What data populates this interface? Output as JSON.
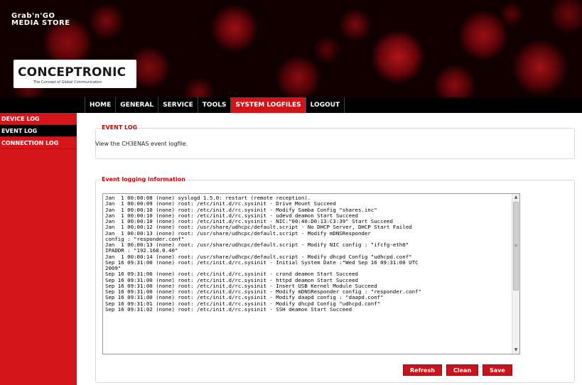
{
  "banner": {
    "store_line1": "Grab'n'GO",
    "store_line2": "MEDIA STORE",
    "brand_name": "CONCEPTRONIC",
    "brand_tagline": "The Concept of Global Communication"
  },
  "nav": {
    "items": [
      {
        "label": "HOME"
      },
      {
        "label": "GENERAL"
      },
      {
        "label": "SERVICE"
      },
      {
        "label": "TOOLS"
      },
      {
        "label": "SYSTEM LOGFILES",
        "active": true
      },
      {
        "label": "LOGOUT"
      }
    ],
    "active_color": "#d01418"
  },
  "sidebar": {
    "items": [
      {
        "label": "DEVICE LOG"
      },
      {
        "label": "EVENT LOG",
        "active": true
      },
      {
        "label": "CONNECTION LOG"
      }
    ],
    "color": "#d4161b"
  },
  "event_log": {
    "title": "EVENT LOG",
    "description": "View the CH3ENAS event logfile."
  },
  "info": {
    "title": "Event logging information",
    "log": "Jan  1 00:00:08 (none) syslogd 1.5.0: restart (remote reception).\nJan  1 00:00:09 (none) root: /etc/init.d/rc.sysinit - Drive Mount Succeed\nJan  1 00:00:10 (none) root: /etc/init.d/rc.sysinit - Modify Samba Config \"shares.inc\"\nJan  1 00:00:10 (none) root: /etc/init.d/rc.sysinit - udevd deamon Start Succeed\nJan  1 00:00:10 (none) root: /etc/init.d/rc.sysinit - NIC:\"00:40:D0:13:C3:39\" Start Succeed\nJan  1 00:00:12 (none) root: /usr/share/udhcpc/default.script - No DHCP Server, DHCP Start Failed\nJan  1 00:00:13 (none) root: /usr/share/udhcpc/default.script - Modify mDNSResponder\nconfig : \"responder.conf\"\nJan  1 00:00:13 (none) root: /usr/share/udhcpc/default.script - Modify NIC config : \"ifcfg-eth0\"\nIPADDR : \"192.168.0.40\"\nJan  1 00:00:14 (none) root: /usr/share/udhcpc/default.script - Modify dhcpd Config \"udhcpd.conf\"\nSep 16 09:31:00 (none) root: /etc/init.d/rc.sysinit - Initial System Date :\"Wed Sep 16 09:31:00 UTC\n2009\"\nSep 16 09:31:00 (none) root: /etc/init.d/rc.sysinit - crond deamon Start Succeed\nSep 16 09:31:00 (none) root: /etc/init.d/rc.sysinit - httpd deamon Start Succeed\nSep 16 09:31:00 (none) root: /etc/init.d/rc.sysinit - Insert USB Kernel Module Succeed\nSep 16 09:31:00 (none) root: /etc/init.d/rc.sysinit - Modify mDNSResponder config : \"responder.conf\"\nSep 16 09:31:00 (none) root: /etc/init.d/rc.sysinit - Modify daapd config : \"daapd.conf\"\nSep 16 09:31:01 (none) root: /etc/init.d/rc.sysinit - Modify dhcpd Config \"udhcpd.conf\"\nSep 16 09:31:02 (none) root: /etc/init.d/rc.sysinit - SSH deamon Start Succeed"
  },
  "buttons": {
    "refresh": "Refresh",
    "clean": "Clean",
    "save": "Save"
  },
  "icons": {
    "scroll_up": "▲",
    "scroll_down": "▼",
    "scroll_grip": "≡"
  }
}
